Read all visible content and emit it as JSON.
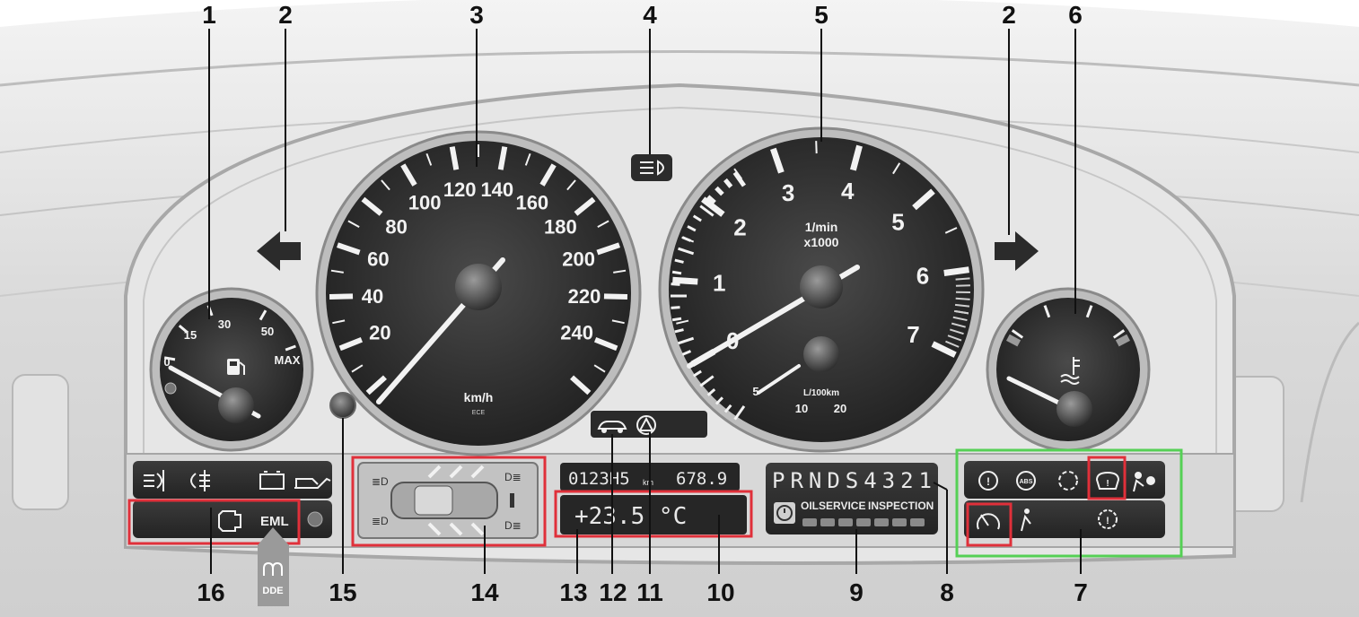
{
  "callouts": {
    "c1": "1",
    "c2a": "2",
    "c3": "3",
    "c4": "4",
    "c5": "5",
    "c2b": "2",
    "c6": "6",
    "c16": "16",
    "c15": "15",
    "c14": "14",
    "c13": "13",
    "c12": "12",
    "c11": "11",
    "c10": "10",
    "c9": "9",
    "c8": "8",
    "c7": "7"
  },
  "fuel_gauge": {
    "labels": [
      "0",
      "15",
      "30",
      "50",
      "MAX"
    ],
    "icon": "fuel-pump-icon",
    "level": 0
  },
  "speedometer": {
    "labels": [
      "20",
      "40",
      "60",
      "80",
      "100",
      "120",
      "140",
      "160",
      "180",
      "200",
      "220",
      "240"
    ],
    "unit": "km/h",
    "unit_sub": "ECE",
    "reading": 0
  },
  "tachometer": {
    "labels": [
      "0",
      "1",
      "2",
      "3",
      "4",
      "5",
      "6",
      "7"
    ],
    "unit_line1": "1/min",
    "unit_line2": "x1000",
    "economy_labels": [
      "5",
      "10",
      "20"
    ],
    "economy_unit": "L/100km",
    "reading": 0
  },
  "temp_gauge": {
    "icon": "coolant-temperature-icon"
  },
  "odometer": {
    "total": "0123H5",
    "unit": "km",
    "trip": "678.9"
  },
  "outside_temp": {
    "value": "+23.5 °C"
  },
  "gear_display": {
    "text": "PRNDS4321"
  },
  "service": {
    "oil_label": "OILSERVICE",
    "inspection_label": "INSPECTION"
  },
  "eml_label": "EML",
  "dde_label": "DDE",
  "colors": {
    "highlight_red": "#e0303a",
    "highlight_green": "#55d055",
    "gauge_face": "#2f2f2f",
    "dashboard": "#d4d4d4"
  },
  "icons": [
    "front-fog-light-icon",
    "rear-fog-light-icon",
    "battery-icon",
    "oil-can-icon",
    "engine-check-icon",
    "headlight-range-icon",
    "vehicle-check-icon",
    "warning-triangle-icon",
    "brake-warning-icon",
    "abs-icon",
    "brake-pad-icon",
    "tire-pressure-icon",
    "airbag-icon",
    "speedometer-warning-icon",
    "seatbelt-icon",
    "transmission-warning-icon",
    "left-turn-arrow-icon",
    "right-turn-arrow-icon",
    "preheat-coil-icon",
    "clock-icon"
  ]
}
